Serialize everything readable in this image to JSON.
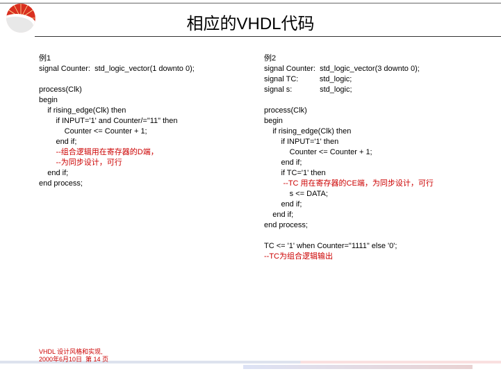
{
  "title": "相应的VHDL代码",
  "left": {
    "heading": "例1",
    "sig": "signal Counter:  std_logic_vector(1 downto 0);",
    "p1": "process(Clk)",
    "p2": "begin",
    "p3": "    if rising_edge(Clk) then",
    "p4": "        if INPUT='1' and Counter/=\"11\" then",
    "p5": "            Counter <= Counter + 1;",
    "p6": "        end if;",
    "c1": "        --组合逻辑用在寄存器的D端，",
    "c2": "        --为同步设计，可行",
    "p7": "    end if;",
    "p8": "end process;"
  },
  "right": {
    "heading": "例2",
    "sig1": "signal Counter:  std_logic_vector(3 downto 0);",
    "sig2": "signal TC:          std_logic;",
    "sig3": "signal s:             std_logic;",
    "p1": "process(Clk)",
    "p2": "begin",
    "p3": "    if rising_edge(Clk) then",
    "p4": "        if INPUT='1' then",
    "p5": "            Counter <= Counter + 1;",
    "p6": "        end if;",
    "p7": "        if TC='1' then",
    "c1a": "         --TC 用在寄存器的CE端，为同步设计，可行",
    "p8": "            s <= DATA;",
    "p9": "        end if;",
    "p10": "    end if;",
    "p11": "end process;",
    "tc": "TC <= '1' when Counter=\"1111\" else '0';",
    "c2": "--TC为组合逻辑输出"
  },
  "footer": {
    "line1": "VHDL 设计风格和实现,",
    "line2": "2000年6月10日  第 14 页"
  }
}
